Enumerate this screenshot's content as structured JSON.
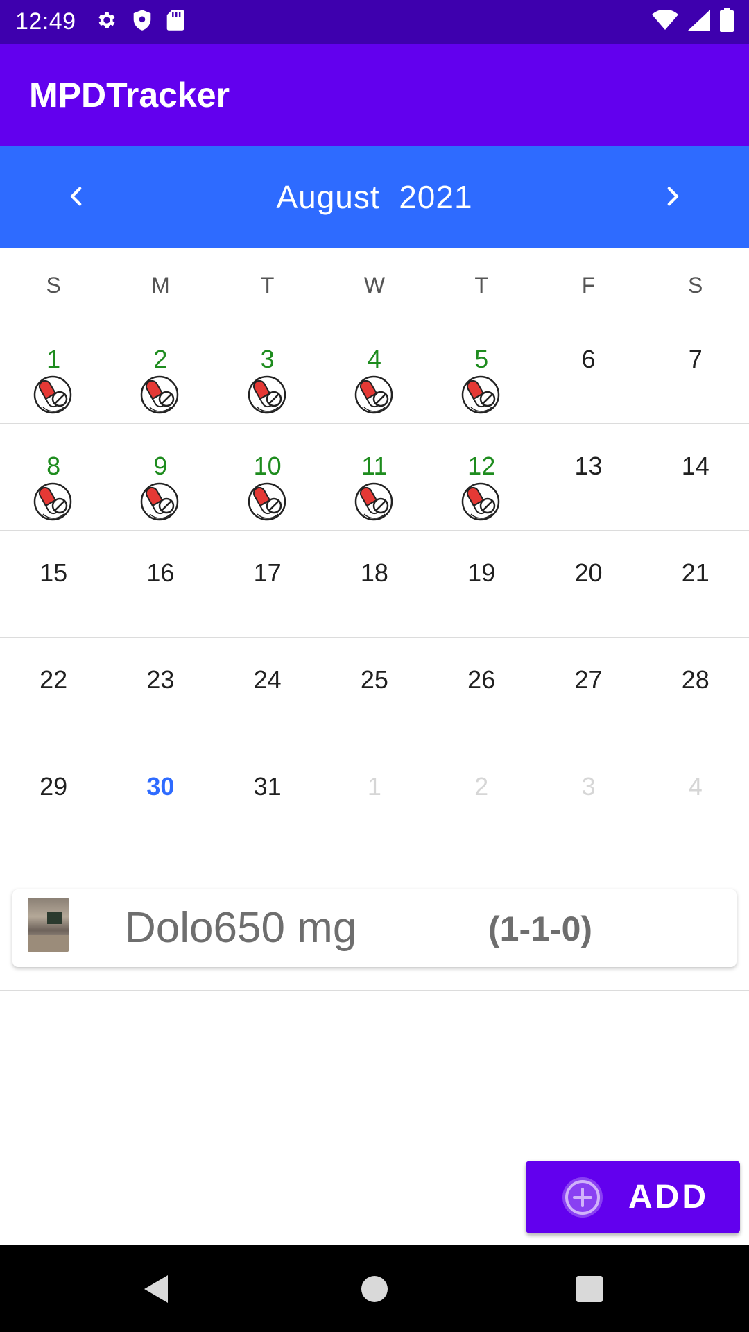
{
  "status_bar": {
    "time": "12:49",
    "icons": [
      "gear-icon",
      "shield-icon",
      "sd-card-icon",
      "wifi-icon",
      "signal-icon",
      "battery-icon"
    ]
  },
  "app_bar": {
    "title": "MPDTracker"
  },
  "calendar": {
    "month_label": "August  2021",
    "weekdays": [
      "S",
      "M",
      "T",
      "W",
      "T",
      "F",
      "S"
    ],
    "weeks": [
      [
        {
          "d": "1",
          "s": "done",
          "pill": true
        },
        {
          "d": "2",
          "s": "done",
          "pill": true
        },
        {
          "d": "3",
          "s": "done",
          "pill": true
        },
        {
          "d": "4",
          "s": "done",
          "pill": true
        },
        {
          "d": "5",
          "s": "done",
          "pill": true
        },
        {
          "d": "6",
          "s": "normal",
          "pill": false
        },
        {
          "d": "7",
          "s": "normal",
          "pill": false
        }
      ],
      [
        {
          "d": "8",
          "s": "done",
          "pill": true
        },
        {
          "d": "9",
          "s": "done",
          "pill": true
        },
        {
          "d": "10",
          "s": "done",
          "pill": true
        },
        {
          "d": "11",
          "s": "done",
          "pill": true
        },
        {
          "d": "12",
          "s": "done",
          "pill": true
        },
        {
          "d": "13",
          "s": "normal",
          "pill": false
        },
        {
          "d": "14",
          "s": "normal",
          "pill": false
        }
      ],
      [
        {
          "d": "15",
          "s": "normal",
          "pill": false
        },
        {
          "d": "16",
          "s": "normal",
          "pill": false
        },
        {
          "d": "17",
          "s": "normal",
          "pill": false
        },
        {
          "d": "18",
          "s": "normal",
          "pill": false
        },
        {
          "d": "19",
          "s": "normal",
          "pill": false
        },
        {
          "d": "20",
          "s": "normal",
          "pill": false
        },
        {
          "d": "21",
          "s": "normal",
          "pill": false
        }
      ],
      [
        {
          "d": "22",
          "s": "normal",
          "pill": false
        },
        {
          "d": "23",
          "s": "normal",
          "pill": false
        },
        {
          "d": "24",
          "s": "normal",
          "pill": false
        },
        {
          "d": "25",
          "s": "normal",
          "pill": false
        },
        {
          "d": "26",
          "s": "normal",
          "pill": false
        },
        {
          "d": "27",
          "s": "normal",
          "pill": false
        },
        {
          "d": "28",
          "s": "normal",
          "pill": false
        }
      ],
      [
        {
          "d": "29",
          "s": "normal",
          "pill": false
        },
        {
          "d": "30",
          "s": "today",
          "pill": false
        },
        {
          "d": "31",
          "s": "normal",
          "pill": false
        },
        {
          "d": "1",
          "s": "other",
          "pill": false
        },
        {
          "d": "2",
          "s": "other",
          "pill": false
        },
        {
          "d": "3",
          "s": "other",
          "pill": false
        },
        {
          "d": "4",
          "s": "other",
          "pill": false
        }
      ]
    ]
  },
  "medication": {
    "name": "Dolo650 mg",
    "dose": "(1-1-0)"
  },
  "add_button": {
    "label": "ADD"
  },
  "colors": {
    "status_bar": "#3E00AE",
    "app_bar": "#6200EE",
    "month_header": "#2E6BFF",
    "taken_day": "#1E8C1E",
    "today": "#2E6BFF"
  }
}
